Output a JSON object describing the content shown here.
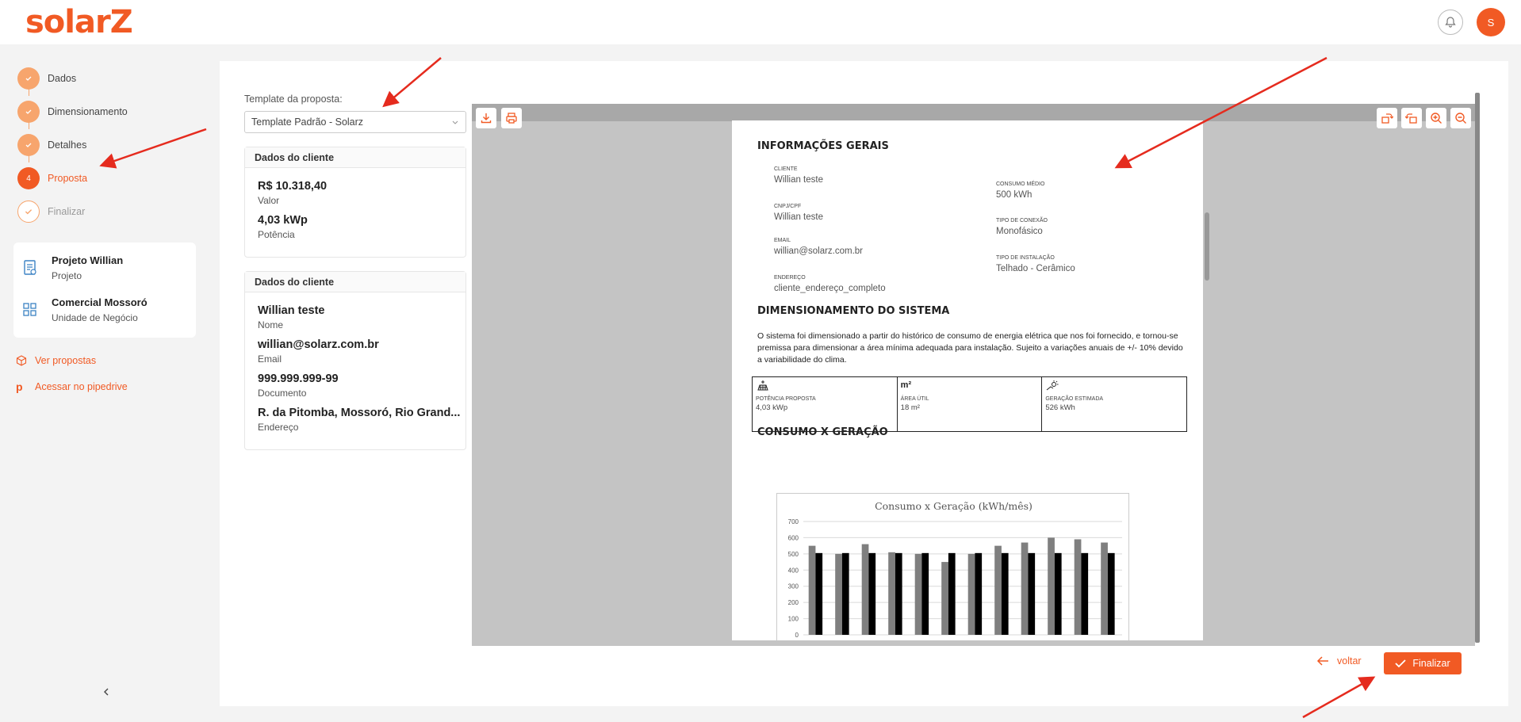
{
  "brand": {
    "logo_text": "solarZ",
    "accent": "#f15a24",
    "accent_light": "#f7a56d"
  },
  "header": {
    "notifications_icon": "bell-icon",
    "avatar_initial": "S"
  },
  "steps": [
    {
      "label": "Dados",
      "state": "done",
      "icon": "check-icon"
    },
    {
      "label": "Dimensionamento",
      "state": "done",
      "icon": "check-icon"
    },
    {
      "label": "Detalhes",
      "state": "done",
      "icon": "check-icon"
    },
    {
      "label": "Proposta",
      "state": "current",
      "number": "4"
    },
    {
      "label": "Finalizar",
      "state": "todo",
      "icon": "check-icon"
    }
  ],
  "project_card": {
    "project": {
      "title": "Projeto Willian",
      "subtitle": "Projeto",
      "icon": "document-icon"
    },
    "unit": {
      "title": "Comercial Mossoró",
      "subtitle": "Unidade de Negócio",
      "icon": "grid-icon"
    }
  },
  "side_links": [
    {
      "label": "Ver propostas",
      "icon": "box-icon"
    },
    {
      "label": "Acessar no pipedrive",
      "icon": "pipedrive-icon"
    }
  ],
  "template": {
    "label": "Template da proposta:",
    "selected": "Template Padrão - Solarz"
  },
  "summary_card": {
    "title": "Dados do cliente",
    "items": [
      {
        "value": "R$ 10.318,40",
        "key": "Valor"
      },
      {
        "value": "4,03 kWp",
        "key": "Potência"
      }
    ]
  },
  "client_card": {
    "title": "Dados do cliente",
    "items": [
      {
        "value": "Willian teste",
        "key": "Nome"
      },
      {
        "value": "willian@solarz.com.br",
        "key": "Email"
      },
      {
        "value": "999.999.999-99",
        "key": "Documento"
      },
      {
        "value": "R. da Pitomba, Mossoró, Rio Grand...",
        "key": "Endereço"
      }
    ]
  },
  "document": {
    "section1": "INFORMAÇÕES GERAIS",
    "fields": {
      "cliente_lbl": "CLIENTE",
      "cliente": "Willian teste",
      "cnpj_lbl": "CNPJ/CPF",
      "cnpj": "Willian teste",
      "email_lbl": "EMAIL",
      "email": "willian@solarz.com.br",
      "endereco_lbl": "ENDEREÇO",
      "endereco": "cliente_endereço_completo",
      "consumo_lbl": "CONSUMO MÉDIO",
      "consumo": "500 kWh",
      "conexao_lbl": "TIPO DE CONEXÃO",
      "conexao": "Monofásico",
      "instalacao_lbl": "TIPO DE INSTALAÇÃO",
      "instalacao": "Telhado - Cerâmico"
    },
    "section2": "DIMENSIONAMENTO DO SISTEMA",
    "paragraph": "O sistema foi dimensionado a partir do histórico de consumo de energia elétrica que nos foi fornecido, e tornou-se premissa para dimensionar a área mínima adequada para instalação. Sujeito a variações anuais de +/- 10% devido a variabilidade do clima.",
    "metrics": [
      {
        "label": "POTÊNCIA PROPOSTA",
        "value": "4,03 kWp",
        "icon": "solar-panel-icon"
      },
      {
        "label": "ÁREA ÚTIL",
        "value": "18 m²",
        "icon_text": "m²"
      },
      {
        "label": "GERAÇÃO ESTIMADA",
        "value": "526 kWh",
        "icon": "sun-energy-icon"
      }
    ],
    "section3": "CONSUMO X GERAÇÃO"
  },
  "chart_data": {
    "type": "bar",
    "title": "Consumo x Geração (kWh/mês)",
    "categories": [
      "",
      "",
      "",
      "",
      "",
      "",
      "",
      "",
      "",
      "",
      "",
      ""
    ],
    "series": [
      {
        "values": [
          550,
          500,
          560,
          510,
          500,
          450,
          500,
          550,
          570,
          600,
          590,
          570
        ],
        "color": "#7f7f7f"
      },
      {
        "values": [
          505,
          505,
          505,
          505,
          505,
          505,
          505,
          505,
          505,
          505,
          505,
          505
        ],
        "color": "#000000"
      }
    ],
    "yticks": [
      "700",
      "600",
      "500",
      "400",
      "300",
      "200",
      "100",
      "0"
    ],
    "ylim": [
      0,
      700
    ],
    "grid": true
  },
  "actions": {
    "back_label": "voltar",
    "finish_label": "Finalizar"
  }
}
